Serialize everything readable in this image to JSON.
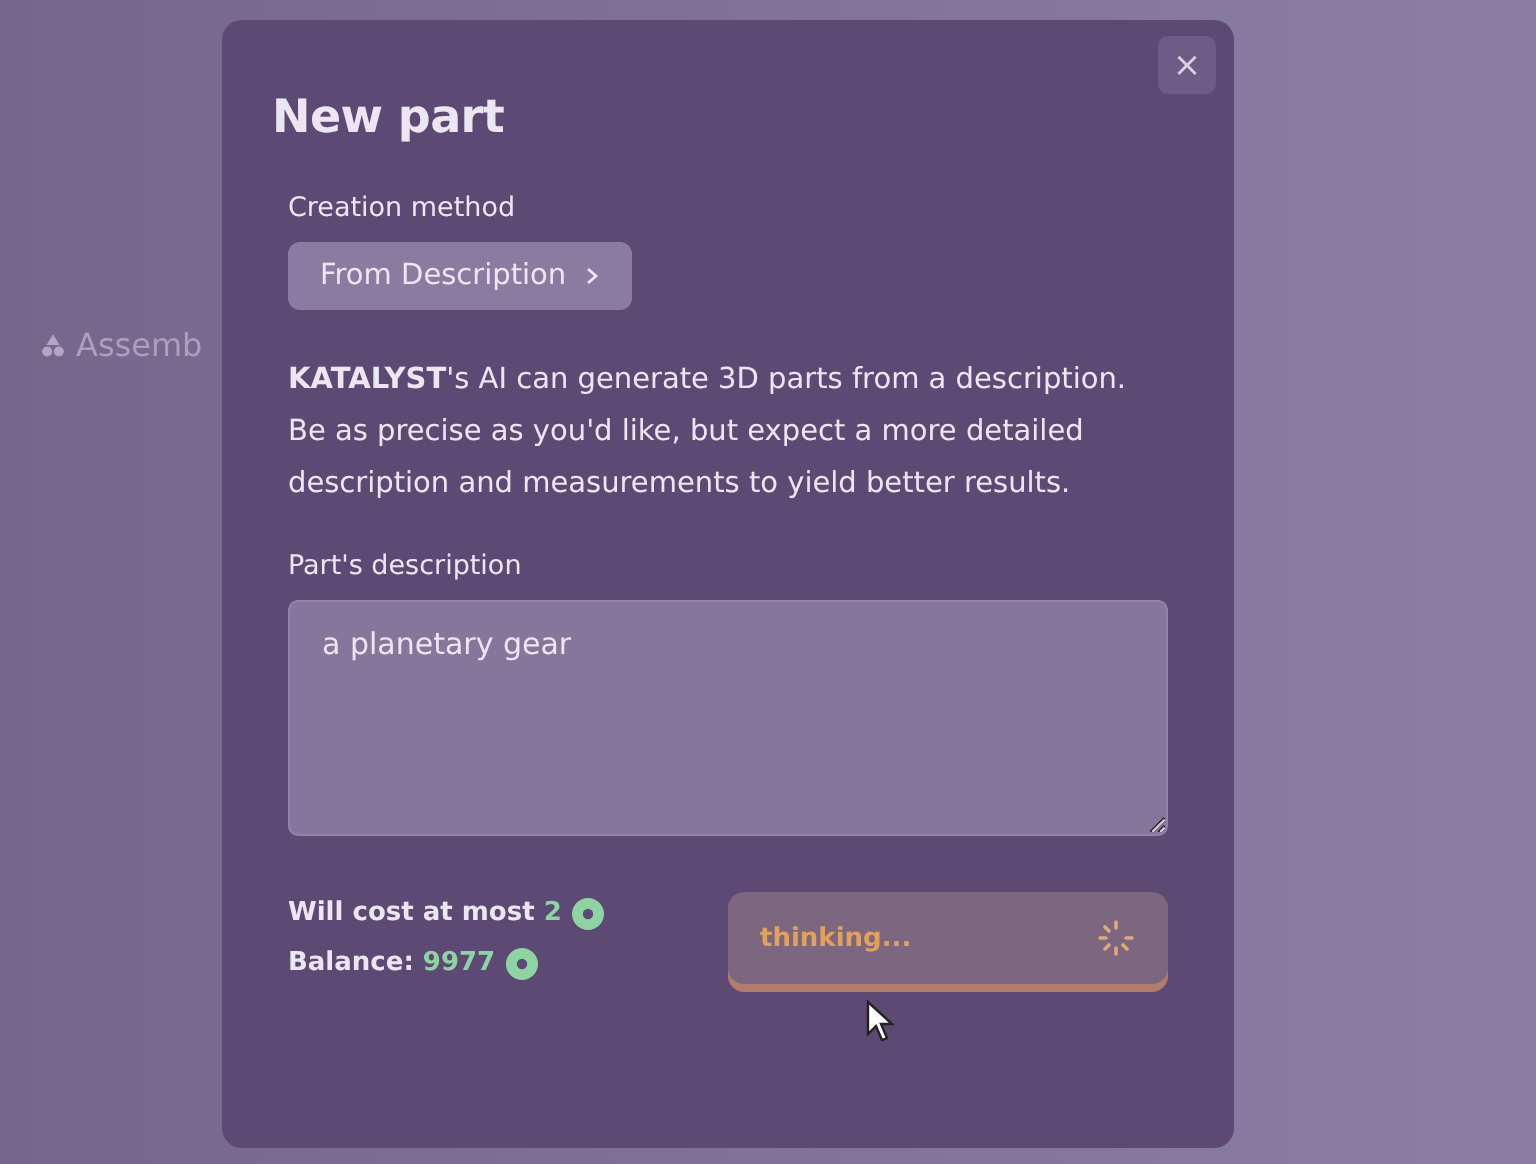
{
  "background": {
    "nav_label": "Assemb"
  },
  "dialog": {
    "title": "New part",
    "close": "×",
    "creation_method": {
      "label": "Creation method",
      "value": "From Description"
    },
    "intro": "**KATALYST**'s AI can generate 3D parts from a description. Be as precise as you'd like, but expect a more detailed description and measurements to yield better results.",
    "description": {
      "label": "Part's description",
      "value": "a planetary gear"
    },
    "cost": {
      "label": "Will cost at most",
      "amount": "2"
    },
    "balance": {
      "label": "Balance:",
      "amount": "9977"
    },
    "submit": {
      "label": "thinking...",
      "busy": true
    }
  }
}
